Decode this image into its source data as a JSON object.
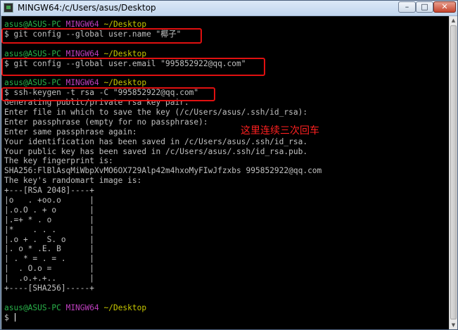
{
  "window": {
    "title": "MINGW64:/c/Users/asus/Desktop",
    "controls": {
      "minimize": "–",
      "maximize": "□",
      "close": "✕"
    }
  },
  "annotation": "这里连续三次回车",
  "colors": {
    "prompt_user": "#29b34a",
    "prompt_env": "#bf3fbf",
    "prompt_path": "#c8c800",
    "highlight_box": "#e01010"
  },
  "terminal": {
    "lines": [
      {
        "u": "asus@ASUS-PC",
        "e": "MINGW64",
        "p": "~/Desktop"
      },
      {
        "t": "$ git config --global user.name \"椰子\""
      },
      {
        "t": ""
      },
      {
        "u": "asus@ASUS-PC",
        "e": "MINGW64",
        "p": "~/Desktop"
      },
      {
        "t": "$ git config --global user.email \"995852922@qq.com\""
      },
      {
        "t": ""
      },
      {
        "u": "asus@ASUS-PC",
        "e": "MINGW64",
        "p": "~/Desktop"
      },
      {
        "t": "$ ssh-keygen -t rsa -C \"995852922@qq.com\""
      },
      {
        "t": "Generating public/private rsa key pair."
      },
      {
        "t": "Enter file in which to save the key (/c/Users/asus/.ssh/id_rsa):"
      },
      {
        "t": "Enter passphrase (empty for no passphrase):"
      },
      {
        "t": "Enter same passphrase again:"
      },
      {
        "t": "Your identification has been saved in /c/Users/asus/.ssh/id_rsa."
      },
      {
        "t": "Your public key has been saved in /c/Users/asus/.ssh/id_rsa.pub."
      },
      {
        "t": "The key fingerprint is:"
      },
      {
        "t": "SHA256:FlBlAsqMiWbpXvMO6OX729Alp42m4hxoMyFIwJfzxbs 995852922@qq.com"
      },
      {
        "t": "The key's randomart image is:"
      },
      {
        "t": "+---[RSA 2048]----+"
      },
      {
        "t": "|o   . +oo.o      |"
      },
      {
        "t": "|.o.O . + o       |"
      },
      {
        "t": "|.=+ * . o        |"
      },
      {
        "t": "|*    . . .       |"
      },
      {
        "t": "|.o + .  S. o     |"
      },
      {
        "t": "|. o * .E. B      |"
      },
      {
        "t": "| . * = . = .     |"
      },
      {
        "t": "|  . O.o =        |"
      },
      {
        "t": "|  .o.+.+..       |"
      },
      {
        "t": "+----[SHA256]-----+"
      },
      {
        "t": ""
      },
      {
        "u": "asus@ASUS-PC",
        "e": "MINGW64",
        "p": "~/Desktop"
      },
      {
        "t": "$ ",
        "cursor": true
      }
    ]
  }
}
